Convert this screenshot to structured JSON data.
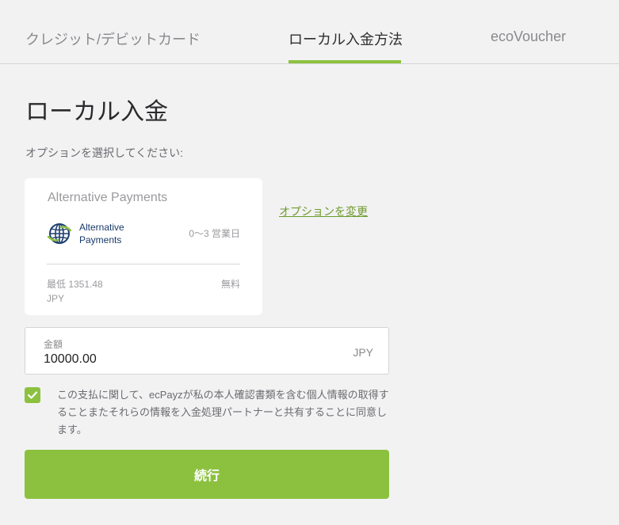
{
  "tabs": [
    {
      "label": "クレジット/デビットカード"
    },
    {
      "label": "ローカル入金方法"
    },
    {
      "label": "ecoVoucher"
    }
  ],
  "page": {
    "title": "ローカル入金",
    "subtitle": "オプションを選択してください:"
  },
  "payment": {
    "title": "Alternative Payments",
    "name_line1": "Alternative",
    "name_line2": "Payments",
    "processing_time": "0〜3 営業日",
    "min_amount": "最低 1351.48",
    "min_currency": "JPY",
    "fee": "無料",
    "icon": "globe-icon"
  },
  "change_option_label": "オプションを変更",
  "amount": {
    "label": "金額",
    "value": "10000.00",
    "currency": "JPY"
  },
  "consent": {
    "checked": true,
    "text": "この支払に関して、ecPayzが私の本人確認書類を含む個人情報の取得することまたそれらの情報を入金処理パートナーと共有することに同意します。"
  },
  "continue_label": "続行",
  "colors": {
    "accent": "#8cc13f",
    "link": "#6e9a2d",
    "background": "#f2f2f3"
  }
}
